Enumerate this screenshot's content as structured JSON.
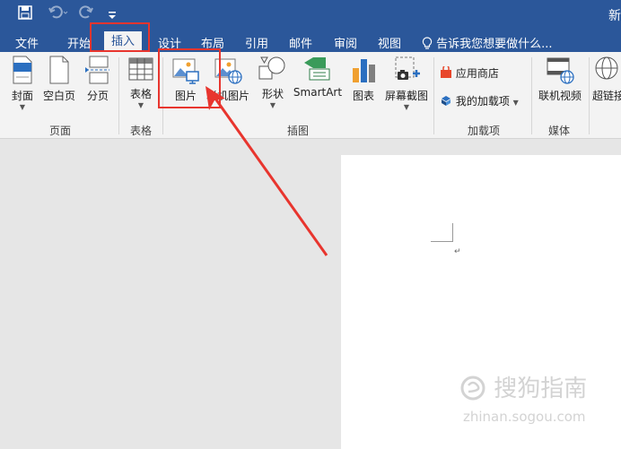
{
  "quick_access": {
    "save": "save-icon",
    "undo": "undo-icon",
    "redo": "redo-icon",
    "customize": "customize-icon"
  },
  "window": {
    "title": "新"
  },
  "tabs": [
    "文件",
    "开始",
    "插入",
    "设计",
    "布局",
    "引用",
    "邮件",
    "审阅",
    "视图"
  ],
  "active_tab": "插入",
  "tell_me": "告诉我您想要做什么...",
  "ribbon": {
    "pages": {
      "cover": "封面",
      "blank": "空白页",
      "break": "分页",
      "group": "页面"
    },
    "tables": {
      "table": "表格",
      "group": "表格"
    },
    "illustrations": {
      "picture": "图片",
      "online_picture": "联机图片",
      "shapes": "形状",
      "smartart": "SmartArt",
      "chart": "图表",
      "screenshot": "屏幕截图",
      "group": "插图"
    },
    "addins": {
      "store": "应用商店",
      "my_addins": "我的加载项",
      "group": "加载项"
    },
    "media": {
      "online_video": "联机视频",
      "group": "媒体"
    },
    "links": {
      "hyperlink": "超链接"
    }
  },
  "watermark": {
    "text": "搜狗指南",
    "url": "zhinan.sogou.com"
  },
  "colors": {
    "accent": "#2b579a",
    "highlight": "#e8352e"
  }
}
